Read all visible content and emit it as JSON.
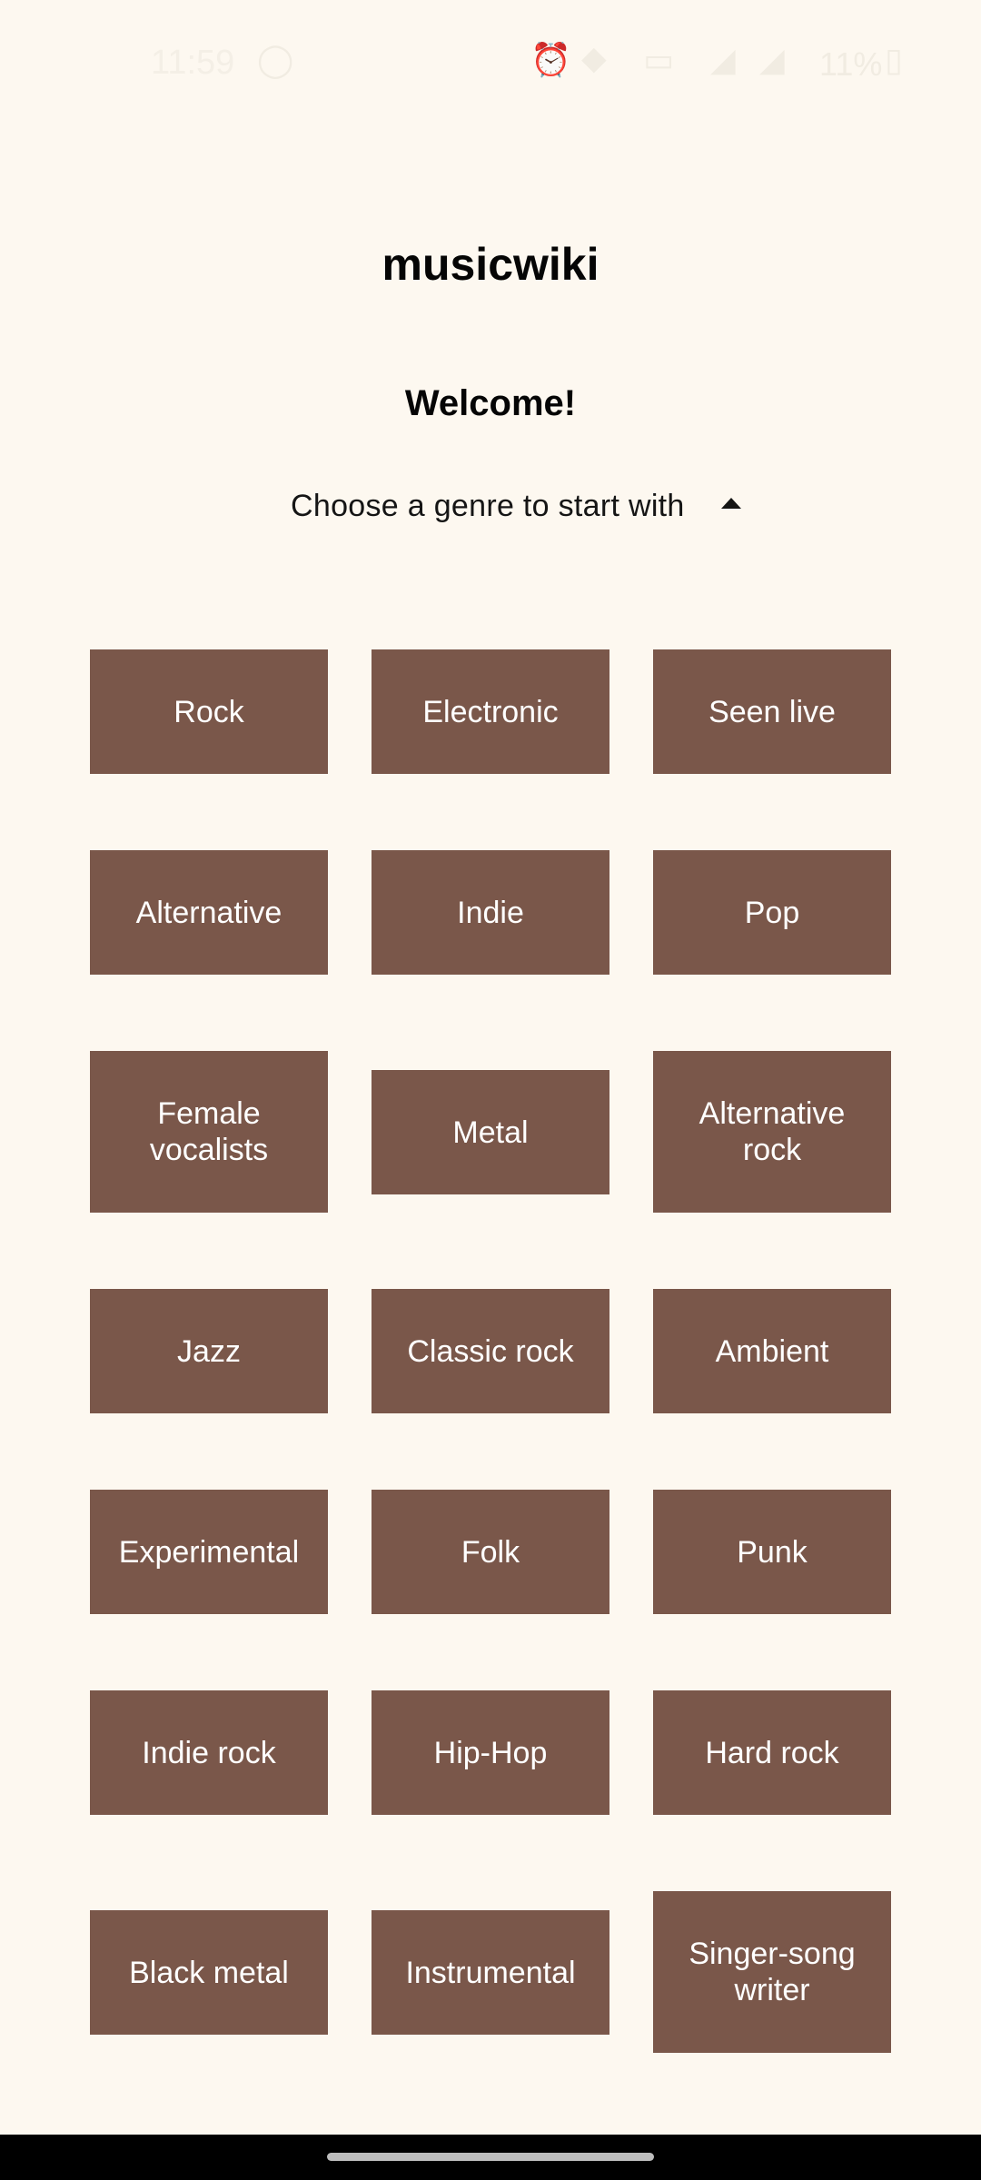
{
  "status_bar": {
    "time": "11:59",
    "battery": "11%"
  },
  "app": {
    "title": "musicwiki",
    "welcome": "Welcome!"
  },
  "chooser": {
    "label": "Choose a genre to start with",
    "icon": "caret-up-icon",
    "expanded": true
  },
  "genres": [
    "Rock",
    "Electronic",
    "Seen live",
    "Alternative",
    "Indie",
    "Pop",
    "Female vocalists",
    "Metal",
    "Alternative rock",
    "Jazz",
    "Classic rock",
    "Ambient",
    "Experimental",
    "Folk",
    "Punk",
    "Indie rock",
    "Hip-Hop",
    "Hard rock",
    "Black metal",
    "Instrumental",
    "Singer-song writer"
  ],
  "colors": {
    "background": "#fdf8f0",
    "tile": "#7a574a",
    "tile_text": "#ffffff",
    "text": "#050505"
  }
}
